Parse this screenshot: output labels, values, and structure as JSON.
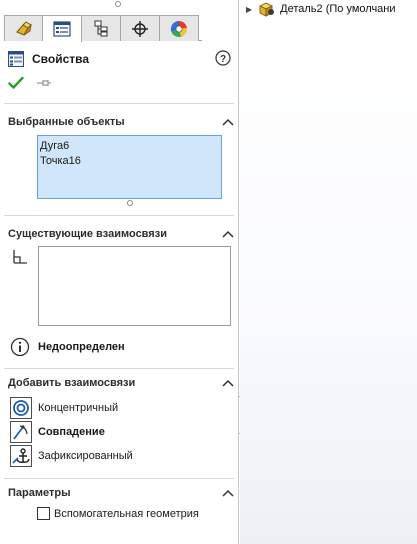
{
  "panel": {
    "title": "Свойства",
    "tabs": [
      {
        "name": "feature-manager",
        "icon": "feature-tree-icon"
      },
      {
        "name": "property-manager",
        "icon": "property-manager-icon",
        "active": true
      },
      {
        "name": "configuration-manager",
        "icon": "configuration-icon"
      },
      {
        "name": "dimxpert-manager",
        "icon": "crosshair-icon"
      },
      {
        "name": "display-manager",
        "icon": "color-wheel-icon"
      }
    ]
  },
  "selected_objects": {
    "header": "Выбранные объекты",
    "items": [
      "Дуга6",
      "Точка16"
    ]
  },
  "existing_relations": {
    "header": "Существующие взаимосвязи",
    "status": "Недоопределен"
  },
  "add_relations": {
    "header": "Добавить взаимосвязи",
    "items": [
      {
        "label": "Концентричный",
        "icon": "concentric-icon"
      },
      {
        "label": "Совпадение",
        "icon": "coincident-icon",
        "bold": true
      },
      {
        "label": "Зафиксированный",
        "icon": "fix-anchor-icon"
      }
    ]
  },
  "parameters": {
    "header": "Параметры",
    "construction_label": "Вспомогательная геометрия",
    "construction_checked": false
  },
  "tree": {
    "root_label": "Деталь2 (По умолчани"
  },
  "colors": {
    "selection_fill": "#cfe6fb",
    "selection_border": "#6a9fd8",
    "ok_green": "#2e9b2e"
  }
}
